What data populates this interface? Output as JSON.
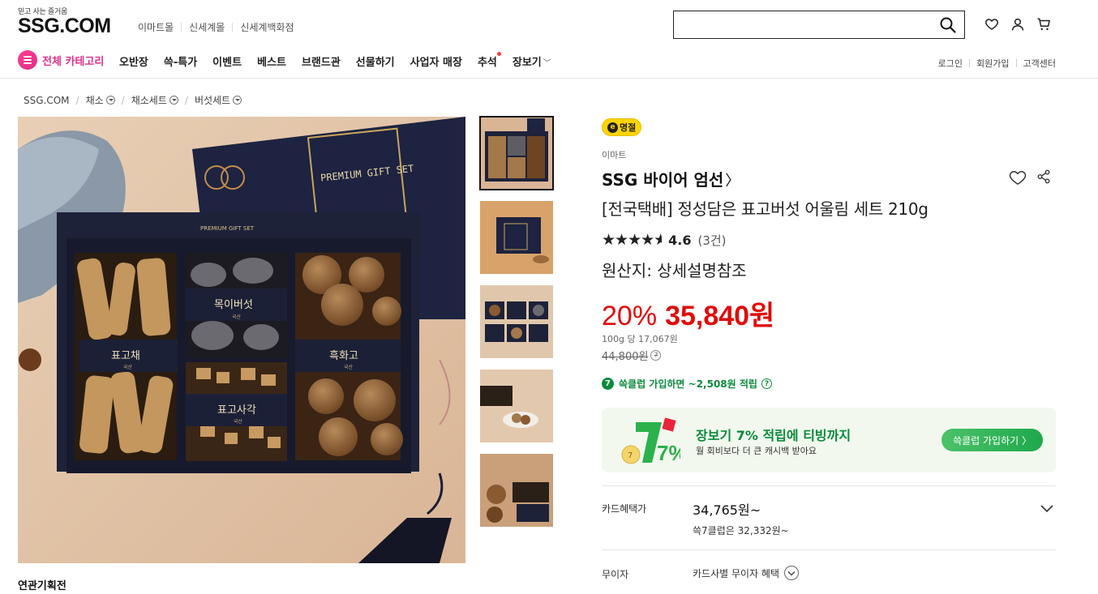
{
  "header": {
    "tagline": "믿고 사는 즐거움",
    "logo": "SSG.COM",
    "mall_links": [
      "이마트몰",
      "신세계몰",
      "신세계백화점"
    ],
    "search_placeholder": "",
    "category_button": "전체 카테고리",
    "nav": [
      "오반장",
      "쓱-특가",
      "이벤트",
      "베스트",
      "브랜드관",
      "선물하기",
      "사업자 매장",
      "추석",
      "장보기"
    ],
    "util": [
      "로그인",
      "회원가입",
      "고객센터"
    ],
    "accent_color": "#e0318a"
  },
  "breadcrumb": [
    "SSG.COM",
    "채소",
    "채소세트",
    "버섯세트"
  ],
  "gallery": {
    "box_lid_text": "PREMIUM GIFT SET",
    "tray_text": "PREMIUM GIFT SET",
    "labels": [
      "표고채",
      "목이버섯",
      "흑화고",
      "표고사각"
    ],
    "origin_tag": "국산"
  },
  "related_title": "연관기획전",
  "product": {
    "badge": "명절",
    "badge_icon": "e",
    "seller": "이마트",
    "brand": "SSG 바이어 엄선",
    "title": "[전국택배] 정성담은 표고버섯 어울림 세트 210g",
    "stars": 4.6,
    "rating": "4.6",
    "review_count": "(3건)",
    "origin": "원산지: 상세설명참조",
    "discount": "20%",
    "price": "35,840원",
    "unit_price": "100g 당 17,067원",
    "original_price": "44,800원",
    "club_icon": "7",
    "club_text": "쓱클럽 가입하면 ~2,508원 적립",
    "price_color": "#e10b0b",
    "club_color": "#0a8a3b"
  },
  "promo": {
    "title": "장보기 7% 적립에 티빙까지",
    "subtitle": "월 회비보다 더 큰 캐시백 받아요",
    "button": "쓱클럽 가입하기 〉",
    "art_text": "7%"
  },
  "benefits": {
    "card_label": "카드혜택가",
    "card_price": "34,765원~",
    "card_sub": "쓱7클럽은 32,332원~",
    "installment_label": "무이자",
    "installment_value": "카드사별 무이자 혜택"
  }
}
